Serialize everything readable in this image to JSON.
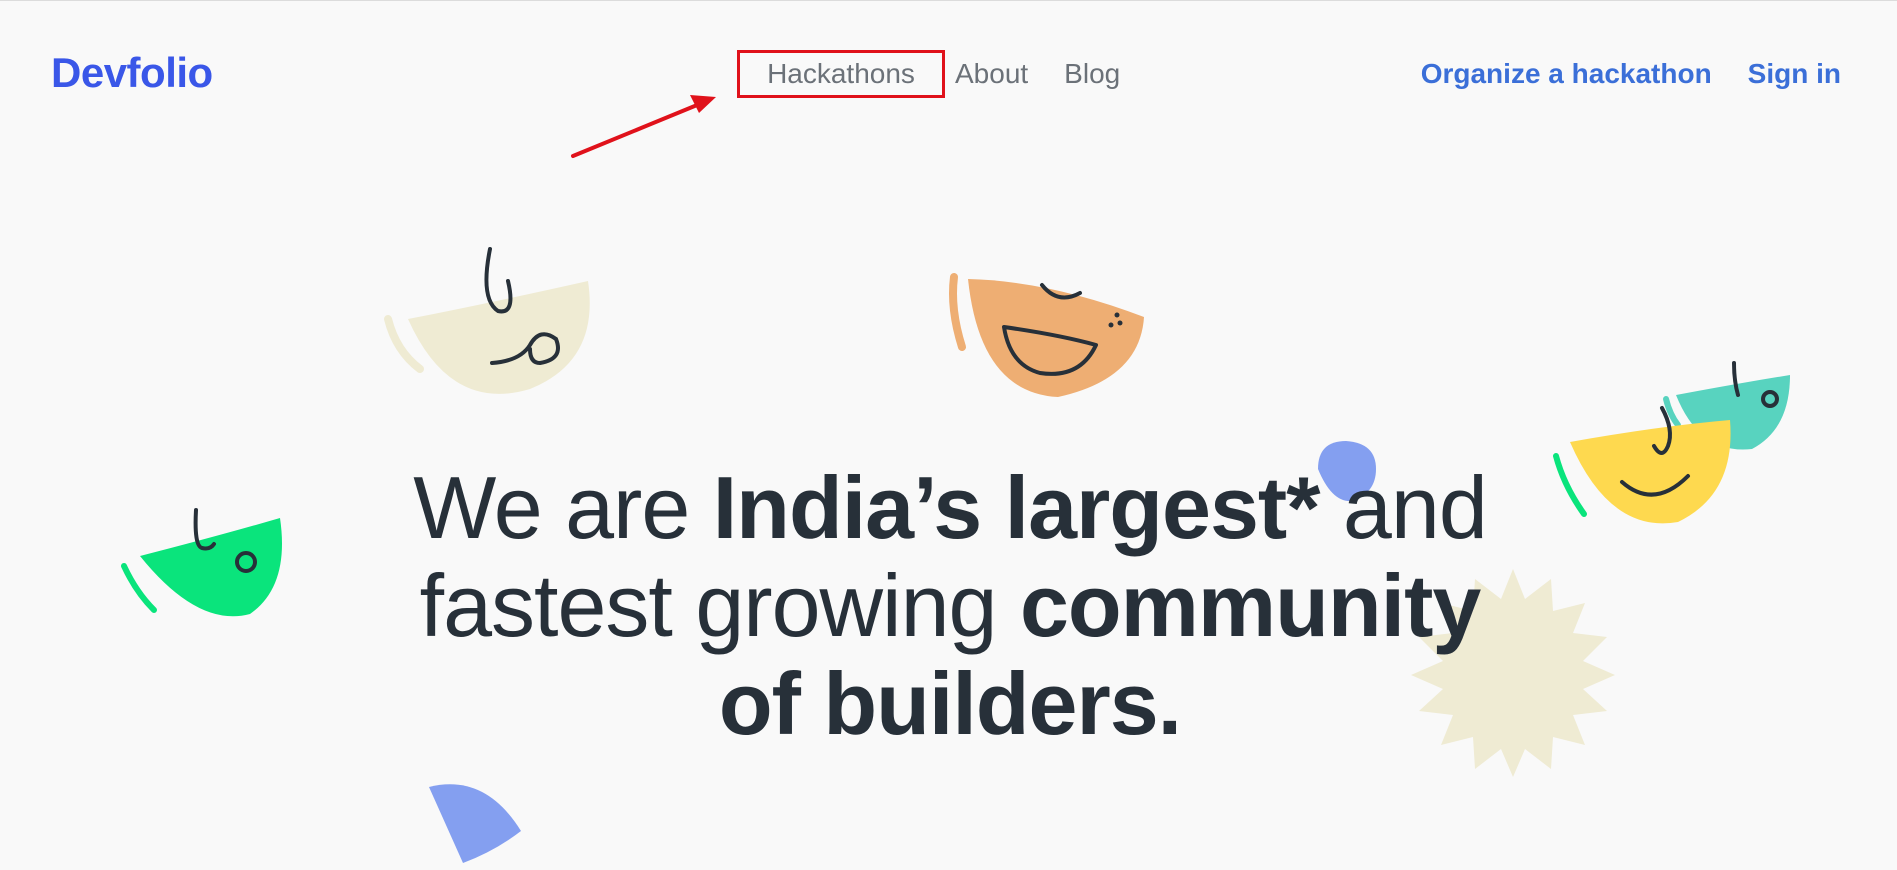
{
  "header": {
    "logo": "Devfolio",
    "nav": {
      "hackathons": "Hackathons",
      "about": "About",
      "blog": "Blog"
    },
    "actions": {
      "organize": "Organize a hackathon",
      "sign_in": "Sign in"
    }
  },
  "hero": {
    "line1_a": "We are ",
    "line1_b": "India’s largest*",
    "line1_c": " and",
    "line2_a": "fastest growing ",
    "line2_b": "community",
    "line3": "of builders."
  },
  "colors": {
    "brand": "#3a57e8",
    "link": "#3b6fd8",
    "highlight_box": "#e0121b",
    "underline": "#19e48a",
    "text": "#273039"
  },
  "icons": [
    "arrow-annotation-icon",
    "blob-face-icon",
    "starburst-icon"
  ]
}
